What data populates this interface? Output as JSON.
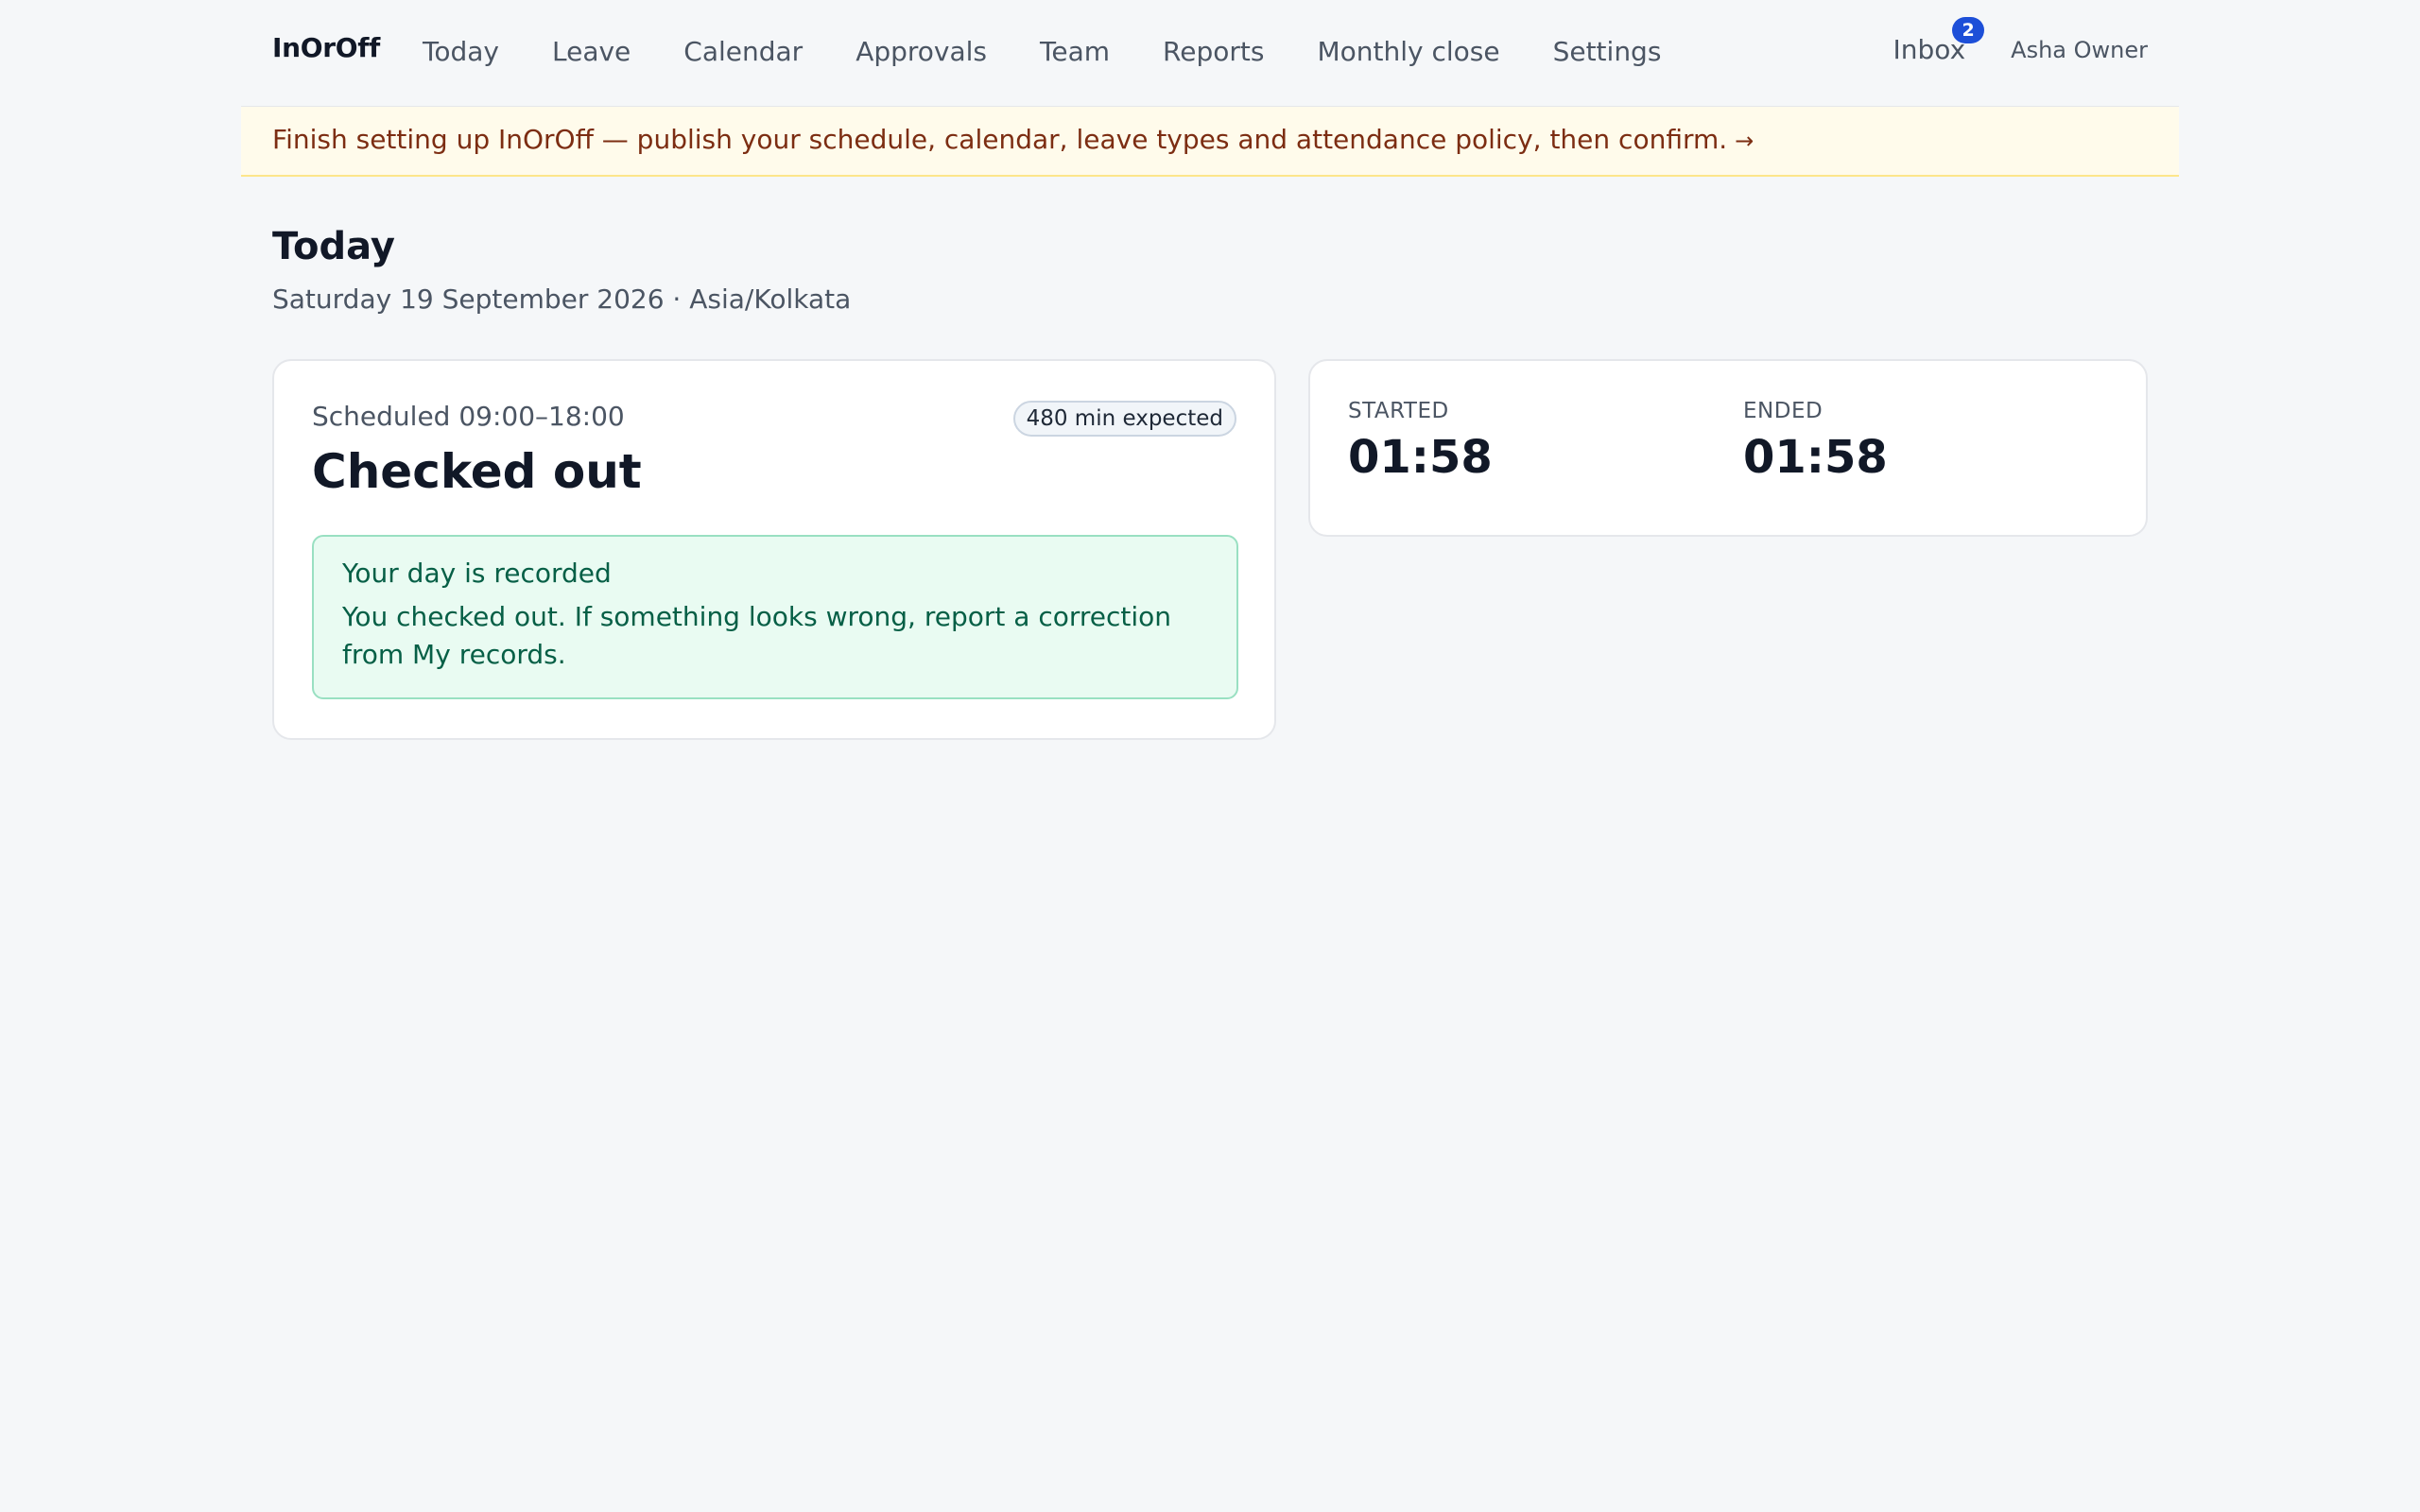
{
  "nav": {
    "brand": "InOrOff",
    "links": [
      "Today",
      "Leave",
      "Calendar",
      "Approvals",
      "Team",
      "Reports",
      "Monthly close",
      "Settings"
    ],
    "inbox_label": "Inbox",
    "inbox_count": "2",
    "user_name": "Asha Owner"
  },
  "banner": {
    "text": "Finish setting up InOrOff — publish your schedule, calendar, leave types and attendance policy, then confirm.",
    "arrow": "→"
  },
  "page": {
    "title": "Today",
    "subtitle": "Saturday 19 September 2026 · Asia/Kolkata"
  },
  "status_card": {
    "schedule": "Scheduled 09:00–18:00",
    "expected_badge": "480 min expected",
    "status": "Checked out",
    "alert_title": "Your day is recorded",
    "alert_body": "You checked out. If something looks wrong, report a correction from My records."
  },
  "times_card": {
    "started_label": "STARTED",
    "started_value": "01:58",
    "ended_label": "ENDED",
    "ended_value": "01:58"
  },
  "colors": {
    "background": "#f5f7f9",
    "banner_bg": "#fffbeb",
    "banner_text": "#7c2d12",
    "badge_blue": "#1d4fd8",
    "success_bg": "#e9fbf2",
    "success_text": "#065f46"
  }
}
